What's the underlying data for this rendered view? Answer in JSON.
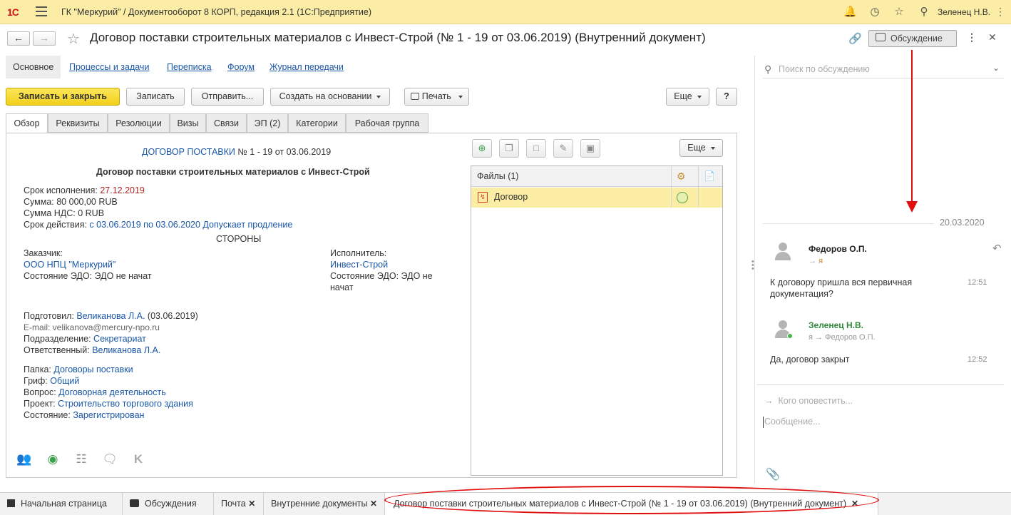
{
  "app": {
    "logo": "1С",
    "title": "ГК \"Меркурий\" / Документооборот 8 КОРП, редакция 2.1  (1С:Предприятие)",
    "user": "Зеленец Н.В."
  },
  "document": {
    "title": "Договор поставки строительных материалов с Инвест-Строй (№ 1 - 19 от 03.06.2019) (Внутренний документ)",
    "discuss_label": "Обсуждение"
  },
  "section_tabs": [
    "Основное",
    "Процессы и задачи",
    "Переписка",
    "Форум",
    "Журнал передачи"
  ],
  "toolbar": {
    "save_close": "Записать и закрыть",
    "save": "Записать",
    "send": "Отправить...",
    "create_based": "Создать на основании",
    "print": "Печать",
    "more": "Еще",
    "help": "?"
  },
  "form_tabs": [
    "Обзор",
    "Реквизиты",
    "Резолюции",
    "Визы",
    "Связи",
    "ЭП (2)",
    "Категории",
    "Рабочая группа"
  ],
  "overview": {
    "doc_type": "ДОГОВОР ПОСТАВКИ",
    "doc_number": " № 1 - 19 от 03.06.2019",
    "heading": "Договор поставки строительных материалов с Инвест-Строй",
    "deadline_label": "Срок исполнения: ",
    "deadline_value": "27.12.2019",
    "sum_label": "Сумма: ",
    "sum_value": "80 000,00 RUB",
    "vat_label": "Сумма НДС: ",
    "vat_value": "0 RUB",
    "validity_label": "Срок действия: ",
    "validity_value": " с 03.06.2019 по 03.06.2020 Допускает продление",
    "parties": "СТОРОНЫ",
    "customer_label": "Заказчик:",
    "customer_value": "ООО НПЦ \"Меркурий\"",
    "customer_edo": "Состояние ЭДО: ЭДО не начат",
    "contractor_label": "Исполнитель:",
    "contractor_value": "Инвест-Строй",
    "contractor_edo_1": "Состояние ЭДО: ЭДО не",
    "contractor_edo_2": "начат",
    "prepared_label": "Подготовил: ",
    "prepared_value": "Великанова Л.А.",
    "prepared_date": " (03.06.2019)",
    "email": "E-mail: velikanova@mercury-npo.ru",
    "dept_label": "Подразделение: ",
    "dept_value": "Секретариат",
    "resp_label": "Ответственный: ",
    "resp_value": "Великанова Л.А.",
    "folder_label": "Папка: ",
    "folder_value": "Договоры поставки",
    "grif_label": "Гриф: ",
    "grif_value": "Общий",
    "question_label": "Вопрос: ",
    "question_value": "Договорная деятельность",
    "project_label": "Проект: ",
    "project_value": "Строительство торгового здания",
    "state_label": "Состояние: ",
    "state_value": "Зарегистрирован"
  },
  "files": {
    "more": "Еще",
    "header": "Файлы (1)",
    "rows": [
      {
        "name": "Договор"
      }
    ]
  },
  "bottom_icons": [
    "users-icon",
    "approval-icon",
    "tree-icon",
    "chat-icon",
    "k-icon"
  ],
  "discussion": {
    "search_placeholder": "Поиск по обсуждению",
    "date": "20.03.2020",
    "messages": [
      {
        "author": "Федоров О.П.",
        "to_prefix": "→ ",
        "to": "я",
        "text": "К договору пришла вся первичная документация?",
        "time": "12:51"
      },
      {
        "author": "Зеленец Н.В.",
        "to_prefix": "я → ",
        "to": "Федоров О.П.",
        "text": "Да, договор закрыт",
        "time": "12:52"
      }
    ],
    "notify_placeholder": "Кого оповестить...",
    "message_placeholder": "Сообщение..."
  },
  "taskbar": [
    {
      "label": "Начальная страница"
    },
    {
      "label": "Обсуждения"
    },
    {
      "label": "Почта"
    },
    {
      "label": "Внутренние документы"
    },
    {
      "label": "Договор поставки строительных материалов с Инвест-Строй (№ 1 - 19 от 03.06.2019) (Внутренний документ)"
    }
  ],
  "colors": {
    "topbar": "#fbeda5",
    "primary_button": "#f2cf1b",
    "link": "#1a57a8",
    "annotation_red": "#e01010",
    "selected_row": "#fbeda3"
  }
}
